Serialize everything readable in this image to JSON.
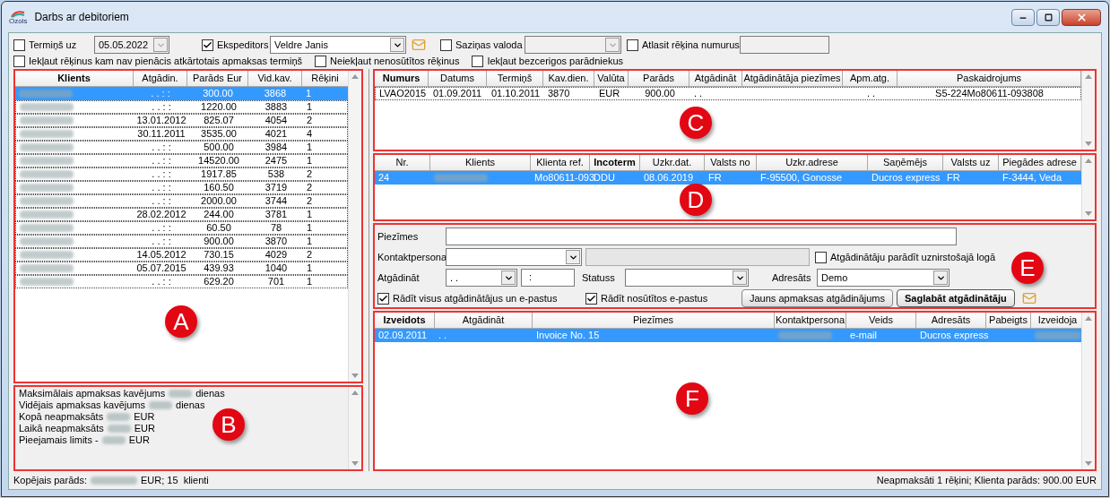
{
  "window": {
    "title": "Darbs ar debitoriem",
    "logo_text": "Ozols"
  },
  "toolbar": {
    "deadline": {
      "label": "Termiņš uz",
      "checked": false,
      "value": "05.05.2022"
    },
    "forwarder": {
      "label": "Ekspeditors",
      "checked": true,
      "value": "Veldre Janis"
    },
    "language": {
      "label": "Saziņas valoda",
      "checked": false
    },
    "invoice_numbers": {
      "label": "Atlasit rēķina numurus",
      "checked": false
    }
  },
  "options": [
    {
      "label": "Iekļaut rēķinus kam nav pienācis atkārtotais apmaksas termiņš",
      "checked": false
    },
    {
      "label": "Neiekļaut nenosūtītos rēķinus",
      "checked": false
    },
    {
      "label": "Iekļaut bezcerigos parādniekus",
      "checked": false
    }
  ],
  "clients": {
    "marker": "A",
    "columns": [
      "Klients",
      "Atgādin.",
      "Parāds Eur",
      "Vid.kav.",
      "Rēķini"
    ],
    "rows": [
      {
        "selected": true,
        "cells": [
          {
            "kind": "blurred"
          },
          ". .    : :",
          "300.00",
          "3868",
          "1"
        ]
      },
      {
        "selected": false,
        "cells": [
          {
            "kind": "blurred"
          },
          ". .    : :",
          "1220.00",
          "3883",
          "1"
        ]
      },
      {
        "selected": false,
        "cells": [
          {
            "kind": "blurred"
          },
          "13.01.2012",
          "825.07",
          "4054",
          "2"
        ]
      },
      {
        "selected": false,
        "cells": [
          {
            "kind": "blurred"
          },
          "30.11.2011",
          "3535.00",
          "4021",
          "4"
        ]
      },
      {
        "selected": false,
        "cells": [
          {
            "kind": "blurred"
          },
          ". .    : :",
          "500.00",
          "3984",
          "1"
        ]
      },
      {
        "selected": false,
        "cells": [
          {
            "kind": "blurred"
          },
          ". .    : :",
          "14520.00",
          "2475",
          "1"
        ]
      },
      {
        "selected": false,
        "cells": [
          {
            "kind": "blurred"
          },
          ". .    : :",
          "1917.85",
          "538",
          "2"
        ]
      },
      {
        "selected": false,
        "cells": [
          {
            "kind": "blurred"
          },
          ". .    : :",
          "160.50",
          "3719",
          "2"
        ]
      },
      {
        "selected": false,
        "cells": [
          {
            "kind": "blurred"
          },
          ". .    : :",
          "2000.00",
          "3744",
          "2"
        ]
      },
      {
        "selected": false,
        "cells": [
          {
            "kind": "blurred"
          },
          "28.02.2012",
          "244.00",
          "3781",
          "1"
        ]
      },
      {
        "selected": false,
        "cells": [
          {
            "kind": "blurred"
          },
          ". .    : :",
          "60.50",
          "78",
          "1"
        ]
      },
      {
        "selected": false,
        "cells": [
          {
            "kind": "blurred"
          },
          ". .    : :",
          "900.00",
          "3870",
          "1"
        ]
      },
      {
        "selected": false,
        "cells": [
          {
            "kind": "blurred"
          },
          "14.05.2012",
          "730.15",
          "4029",
          "2"
        ]
      },
      {
        "selected": false,
        "cells": [
          {
            "kind": "blurred"
          },
          "05.07.2015",
          "439.93",
          "1040",
          "1"
        ]
      },
      {
        "selected": false,
        "cells": [
          {
            "kind": "blurred"
          },
          ". .    : :",
          "629.20",
          "701",
          "1"
        ]
      }
    ]
  },
  "summary": {
    "marker": "B",
    "lines": [
      {
        "before": "Maksimālais apmaksas kavējums",
        "after": "dienas"
      },
      {
        "before": "Vidējais apmaksas kavējums",
        "after": "dienas"
      },
      {
        "before": "Kopā neapmaksāts",
        "after": "EUR"
      },
      {
        "before": "Laikā neapmaksāts",
        "after": "EUR"
      },
      {
        "before": "Pieejamais limits -",
        "after": "EUR"
      }
    ]
  },
  "invoices": {
    "marker": "C",
    "columns": [
      "Numurs",
      "Datums",
      "Termiņš",
      "Kav.dien.",
      "Valūta",
      "Parāds",
      "Atgādināt",
      "Atgādinātāja piezīmes",
      "Apm.atg.",
      "Paskaidrojums"
    ],
    "rows": [
      {
        "selected": false,
        "cells": [
          "LVAO2015",
          "01.09.2011",
          "01.10.2011",
          "3870",
          "EUR",
          "900.00",
          ". .",
          null,
          ". .",
          "S5-224Mo80611-093808"
        ]
      }
    ]
  },
  "shipments": {
    "marker": "D",
    "columns": [
      "Nr.",
      "Klients",
      "Klienta ref.",
      "Incoterm",
      "Uzkr.dat.",
      "Valsts no",
      "Uzkr.adrese",
      "Saņēmējs",
      "Valsts uz",
      "Piegādes adrese"
    ],
    "rows": [
      {
        "selected": true,
        "cells": [
          "24",
          {
            "kind": "blurred"
          },
          "Mo80611-093",
          "DDU",
          "08.06.2019",
          "FR",
          "F-95500, Gonosse",
          "Ducros express",
          "FR",
          "F-3444, Veda"
        ]
      }
    ]
  },
  "reminder_form": {
    "marker": "E",
    "notes": {
      "label": "Piezīmes"
    },
    "contact": {
      "label": "Kontaktpersona"
    },
    "popup": {
      "label": "Atgādinātāju parādīt uznirstošajā logā",
      "checked": false
    },
    "remind": {
      "label": "Atgādināt",
      "date": ". .",
      "time": ":"
    },
    "status": {
      "label": "Statuss"
    },
    "recipient": {
      "label": "Adresāts",
      "value": "Demo"
    },
    "show_all": {
      "label": "Rādīt visus atgādinātājus un e-pastus",
      "checked": true
    },
    "show_sent": {
      "label": "Rādīt nosūtītos e-pastus",
      "checked": true
    },
    "new_button": "Jauns apmaksas atgādinājums",
    "save_button": "Saglabāt atgādinātāju"
  },
  "reminders": {
    "marker": "F",
    "columns": [
      "Izveidots",
      "Atgādināt",
      "Piezīmes",
      "Kontaktpersona",
      "Veids",
      "Adresāts",
      "Pabeigts",
      "Izveidoja"
    ],
    "rows": [
      {
        "selected": true,
        "cells": [
          "02.09.2011",
          ". .",
          "Invoice No. 15",
          {
            "kind": "blurred"
          },
          "e-mail",
          "Ducros express",
          null,
          {
            "kind": "blurred"
          }
        ]
      }
    ]
  },
  "status_bar": {
    "left_before": "Kopējais parāds:",
    "left_after": "EUR; 15  klienti",
    "right": "Neapmaksāti 1 rēķini; Klienta parāds: 900.00 EUR"
  }
}
